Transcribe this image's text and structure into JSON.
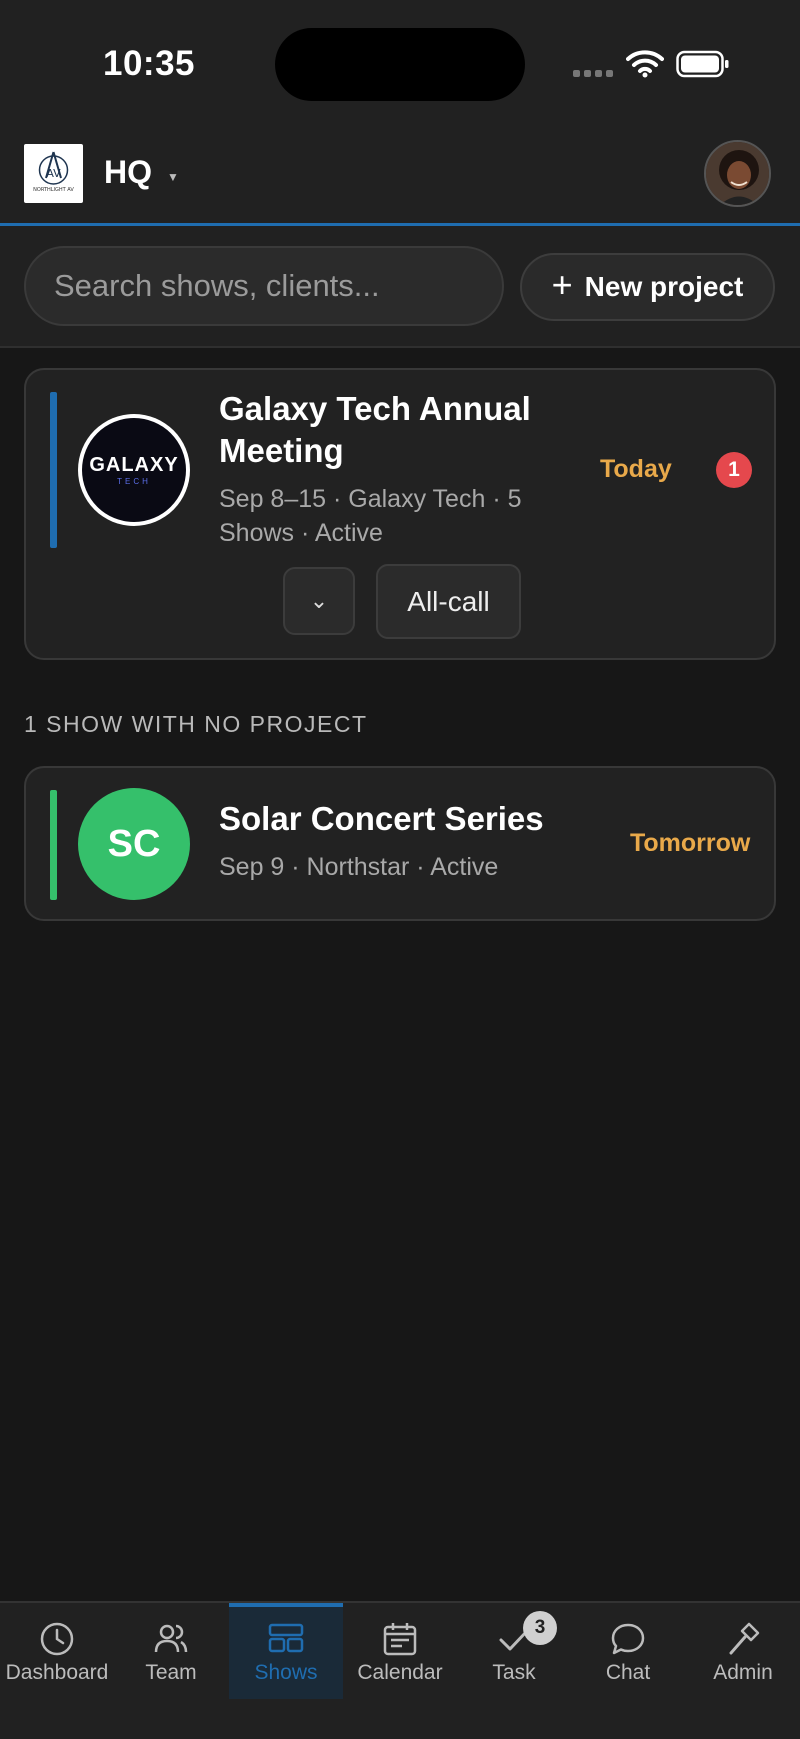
{
  "status_bar": {
    "time": "10:35"
  },
  "header": {
    "org_name": "HQ",
    "logo_text": "NORTHLIGHT AV"
  },
  "toolbar": {
    "search_placeholder": "Search shows, clients...",
    "new_project_label": "New project"
  },
  "project_card": {
    "title_line1": "Galaxy Tech Annual",
    "title_line2": "Meeting",
    "meta_line1": "Sep 8–15 · Galaxy Tech · 5",
    "meta_line2": "Shows · Active",
    "when": "Today",
    "alert_count": "1",
    "logo_text": "GALAXY",
    "logo_subtext": "TECH",
    "expand_label": "⌄",
    "allcall_label": "All-call",
    "accent_color": "#1f6db0"
  },
  "section": {
    "label": "1 SHOW WITH NO PROJECT"
  },
  "show_card": {
    "initials": "SC",
    "title": "Solar Concert Series",
    "meta": "Sep 9 · Northstar · Active",
    "when": "Tomorrow",
    "accent_color": "#35c06b"
  },
  "nav": {
    "items": [
      {
        "label": "Dashboard",
        "icon": "clock-icon"
      },
      {
        "label": "Team",
        "icon": "people-icon"
      },
      {
        "label": "Shows",
        "icon": "shows-icon",
        "active": true
      },
      {
        "label": "Calendar",
        "icon": "calendar-icon"
      },
      {
        "label": "Task",
        "icon": "check-icon"
      },
      {
        "label": "Chat",
        "icon": "chat-bubble-icon"
      },
      {
        "label": "Admin",
        "icon": "hammer-icon"
      }
    ],
    "task_badge": "3"
  },
  "colors": {
    "accent": "#1f6db0",
    "warning": "#e9a94a",
    "alert": "#e5484d",
    "success": "#35c06b"
  }
}
